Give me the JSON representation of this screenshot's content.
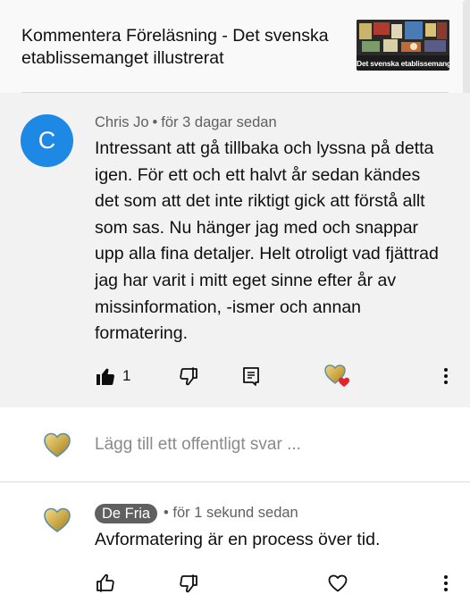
{
  "header": {
    "title": "Kommentera Föreläsning - Det svenska etablissemanget illustrerat",
    "thumbnail_caption": "Det svenska etablissemanget"
  },
  "comment": {
    "avatar_letter": "C",
    "avatar_color": "#1e88e5",
    "author": "Chris Jo",
    "separator": "•",
    "time": "för 3 dagar sedan",
    "text": "Intressant att gå tillbaka och lyssna på detta igen. För ett och ett halvt år sedan kändes det som att det inte riktigt gick att förstå allt som sas. Nu hänger jag med och snappar upp alla fina detaljer. Helt otroligt vad fjättrad jag har varit i mitt eget sinne efter år av missinformation, -ismer och annan formatering.",
    "like_count": "1",
    "icons": [
      "thumbs-up-filled-icon",
      "thumbs-down-icon",
      "reply-comment-icon",
      "creator-heart-icon",
      "more-options-icon"
    ]
  },
  "reply_box": {
    "placeholder": "Lägg till ett offentligt svar ..."
  },
  "reply": {
    "author": "De Fria",
    "separator": "•",
    "time": "för 1 sekund sedan",
    "text": "Avformatering är en process över tid.",
    "icons": [
      "thumbs-up-icon",
      "thumbs-down-icon",
      "heart-outline-icon",
      "more-options-icon"
    ]
  },
  "colors": {
    "accent_blue": "#1e88e5",
    "heart_red": "#e8202a",
    "gold": "#d4a72c",
    "meta_gray": "#606060"
  }
}
